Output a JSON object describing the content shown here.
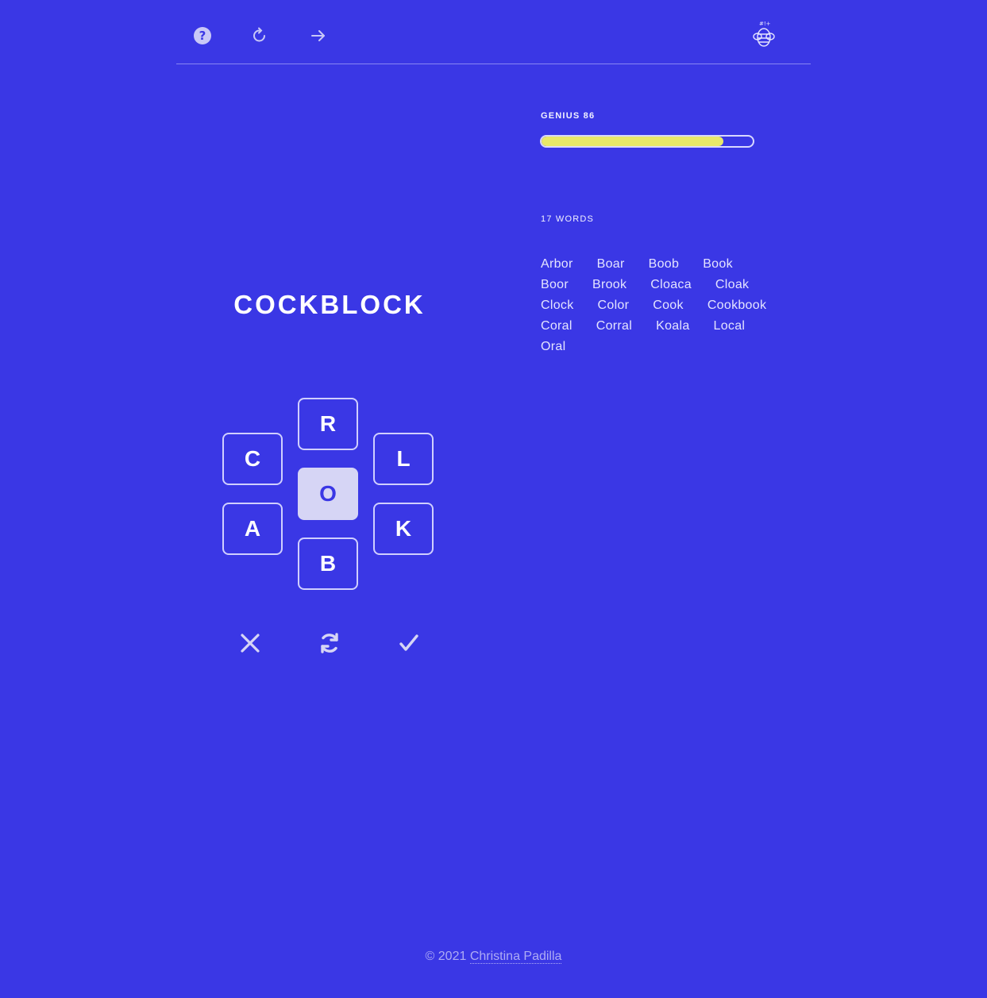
{
  "header": {
    "icons": [
      "help-icon",
      "restart-icon",
      "next-arrow-icon",
      "bee-logo-icon"
    ]
  },
  "score": {
    "rank_label": "GENIUS 86",
    "progress": 0.86,
    "progress_color": "#e8e86a"
  },
  "words": {
    "count_label": "17 WORDS",
    "list": [
      "Arbor",
      "Boar",
      "Boob",
      "Book",
      "Boor",
      "Brook",
      "Cloaca",
      "Cloak",
      "Clock",
      "Color",
      "Cook",
      "Cookbook",
      "Coral",
      "Corral",
      "Koala",
      "Local",
      "Oral"
    ]
  },
  "game": {
    "current_word": "COCKBLOCK",
    "letters": {
      "top": "R",
      "top_left": "C",
      "top_right": "L",
      "center": "O",
      "bottom_left": "A",
      "bottom_right": "K",
      "bottom": "B"
    },
    "actions": [
      "delete-icon",
      "shuffle-icon",
      "submit-check-icon"
    ]
  },
  "footer": {
    "copyright": "© 2021",
    "author": "Christina Padilla"
  },
  "colors": {
    "background": "#3a37e5",
    "center_tile": "#d6d5f5",
    "progress": "#e8e86a"
  }
}
